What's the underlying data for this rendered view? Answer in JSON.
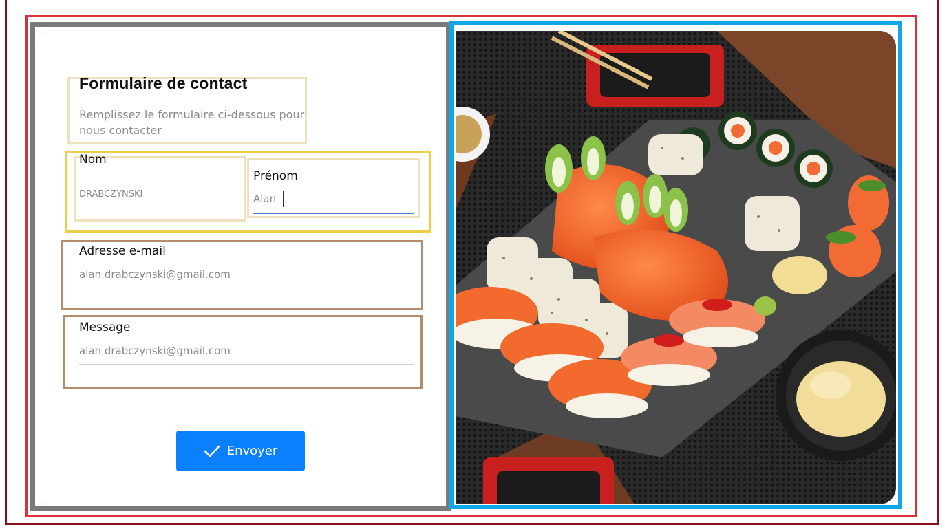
{
  "form": {
    "title": "Formulaire de contact",
    "subtitle": "Remplissez le formulaire ci-dessous pour nous contacter",
    "fields": {
      "nom": {
        "label": "Nom",
        "value": "DRABCZYNSKI"
      },
      "prenom": {
        "label": "Prénom",
        "value": "Alan"
      },
      "email": {
        "label": "Adresse e-mail",
        "value": "alan.drabczynski@gmail.com"
      },
      "message": {
        "label": "Message",
        "value": "alan.drabczynski@gmail.com"
      }
    },
    "submit": {
      "label": "Envoyer",
      "icon": "check-icon"
    }
  },
  "image": {
    "subject": "sushi-platter-photo"
  },
  "colors": {
    "accent": "#0a80ff",
    "active_underline": "#4b7bd6"
  }
}
